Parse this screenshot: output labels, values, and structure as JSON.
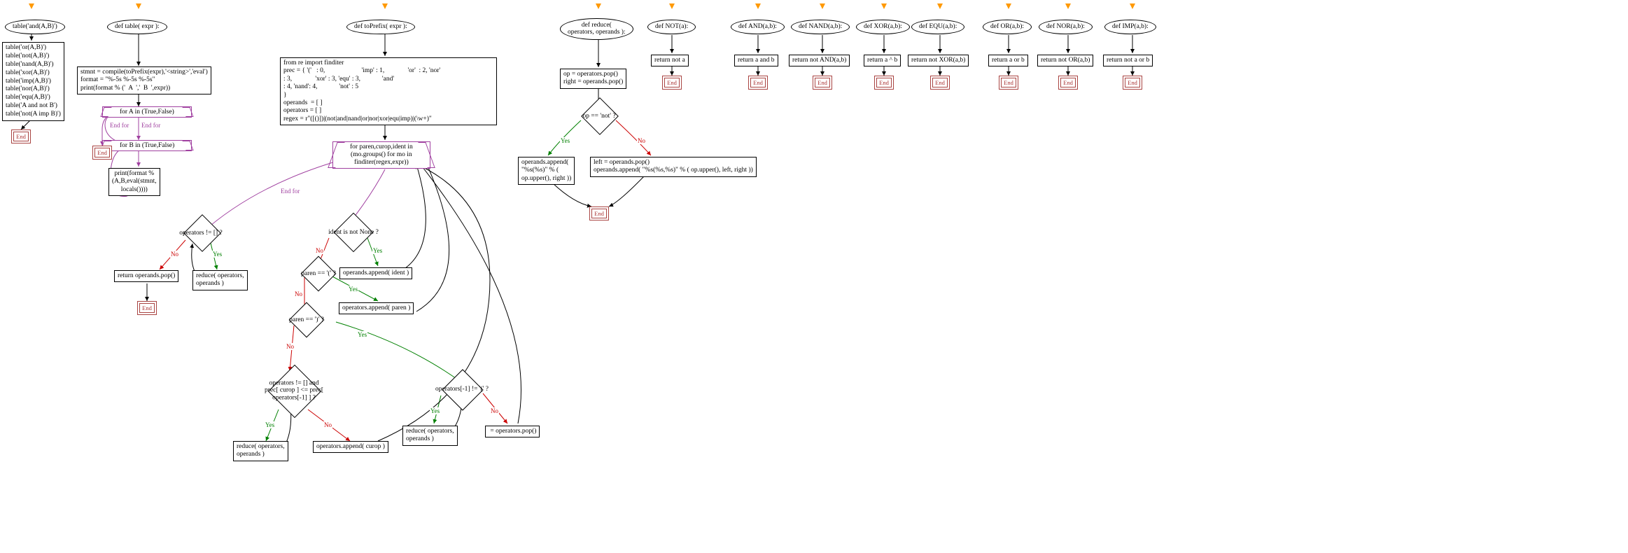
{
  "fc1": {
    "entry": "table('and(A,B)')",
    "calls": [
      "table('or(A,B)')",
      "table('not(A,B)')",
      "table('nand(A,B)')",
      "table('xor(A,B)')",
      "table('imp(A,B)')",
      "table('nor(A,B)')",
      "table('equ(A,B)')",
      "table('A and not B')",
      "table('not(A imp B)')"
    ],
    "end": "End"
  },
  "fc2": {
    "def": "def table( expr ):",
    "body1": "stmnt = compile(toPrefix(expr),'<string>','eval')\nformat = \"%-5s %-5s %-5s\"\nprint(format % ('  A  ','  B  ',expr))",
    "loopA": "for A in (True,False)",
    "loopB": "for B in (True,False)",
    "print": "print(format %\n(A,B,eval(stmnt,\nlocals())))",
    "endfor1": "End for",
    "endfor2": "End for",
    "end": "End"
  },
  "fc3": {
    "def": "def toPrefix( expr ):",
    "setup": "from re import finditer\nprec = { '('   : 0,                      'imp' : 1,              'or'  : 2, 'nor'\n: 3,              'xor' : 3, 'equ' : 3,             'and'\n: 4, 'nand': 4,             'not' : 5   \n}\noperands  = [ ]\noperators = [ ]\nregex = r\"([()])|(not|and|nand|or|nor|xor|equ|imp)|(\\w+)\"",
    "loop": "for paren,curop,ident in\n(mo.groups() for mo in\nfinditer(regex,expr))",
    "while1": "operators != [] ?",
    "reduce1": "reduce( operators,\noperands )",
    "ret": "return operands.pop()",
    "ident": "ident is not None ?",
    "app_ident": "operands.append( ident )",
    "paren_open": "paren == '(' ?",
    "app_paren": "operators.append( paren )",
    "paren_close": "paren == ')' ?",
    "while2": "operators[-1] != '(' ?",
    "reduce2": "reduce( operators,\noperands )",
    "popop": " = operators.pop()",
    "while3": "operators != [] and\nprec[ curop ] <= prec[\noperators[-1] ] ?",
    "reduce3": "reduce( operators,\noperands )",
    "app_curop": "operators.append( curop )",
    "endfor": "End for",
    "yes": "Yes",
    "no": "No",
    "end": "End"
  },
  "fc4": {
    "def": "def reduce(\noperators, operands ):",
    "pop": "op = operators.pop()\nright = operands.pop()",
    "cond": "op == 'not' ?",
    "then": "operands.append(\n\"%s(%s)\" % (\nop.upper(), right ))",
    "else": "left = operands.pop()\noperands.append( \"%s(%s,%s)\" % ( op.upper(), left, right ))",
    "yes": "Yes",
    "no": "No",
    "end": "End"
  },
  "fc5": {
    "def": "def NOT(a):",
    "ret": "return not a",
    "end": "End"
  },
  "fc6": {
    "def": "def AND(a,b):",
    "ret": "return a and b",
    "end": "End"
  },
  "fc7": {
    "def": "def NAND(a,b):",
    "ret": "return not AND(a,b)",
    "end": "End"
  },
  "fc8": {
    "def": "def XOR(a,b):",
    "ret": "return a ^ b",
    "end": "End"
  },
  "fc9": {
    "def": "def EQU(a,b):",
    "ret": "return not XOR(a,b)",
    "end": "End"
  },
  "fc10": {
    "def": "def OR(a,b):",
    "ret": "return a or b",
    "end": "End"
  },
  "fc11": {
    "def": "def NOR(a,b):",
    "ret": "return not OR(a,b)",
    "end": "End"
  },
  "fc12": {
    "def": "def IMP(a,b):",
    "ret": "return not a or b",
    "end": "End"
  },
  "chart_data": {
    "type": "flowchart",
    "graphs": [
      {
        "id": "main",
        "nodes": [
          {
            "id": "n1",
            "kind": "process",
            "label": "table('and(A,B)')"
          },
          {
            "id": "n2",
            "kind": "process",
            "label": "table('or(A,B)')\ntable('not(A,B)')\ntable('nand(A,B)')\ntable('xor(A,B)')\ntable('imp(A,B)')\ntable('nor(A,B)')\ntable('equ(A,B)')\ntable('A and not B')\ntable('not(A imp B)')"
          },
          {
            "id": "n3",
            "kind": "end",
            "label": "End"
          }
        ],
        "edges": [
          [
            "entry",
            "n1"
          ],
          [
            "n1",
            "n2"
          ],
          [
            "n2",
            "n3"
          ]
        ]
      },
      {
        "id": "table",
        "nodes": [
          {
            "id": "d",
            "kind": "oval",
            "label": "def table( expr ):"
          },
          {
            "id": "s1",
            "kind": "process",
            "label": "stmnt = compile(toPrefix(expr),'<string>','eval')\nformat = \"%-5s %-5s %-5s\"\nprint(format % ('  A  ','  B  ',expr))"
          },
          {
            "id": "fA",
            "kind": "for",
            "label": "for A in (True,False)"
          },
          {
            "id": "fB",
            "kind": "for",
            "label": "for B in (True,False)"
          },
          {
            "id": "pr",
            "kind": "process",
            "label": "print(format % (A,B,eval(stmnt,locals())))"
          },
          {
            "id": "eA",
            "kind": "end",
            "label": "End"
          }
        ],
        "edges": [
          [
            "entry",
            "d"
          ],
          [
            "d",
            "s1"
          ],
          [
            "s1",
            "fA"
          ],
          [
            "fA",
            "fB",
            "body"
          ],
          [
            "fB",
            "pr",
            "body"
          ],
          [
            "pr",
            "fB"
          ],
          [
            "fB",
            "fA",
            "End for"
          ],
          [
            "fA",
            "eA",
            "End for"
          ]
        ]
      },
      {
        "id": "toPrefix",
        "nodes": [
          {
            "id": "d",
            "kind": "oval",
            "label": "def toPrefix( expr ):"
          },
          {
            "id": "init",
            "kind": "process",
            "label": "from re import finditer; prec = {...}; operands=[]; operators=[]; regex=r\"([()])|(not|and|nand|or|nor|xor|equ|imp)|(\\w+)\""
          },
          {
            "id": "for",
            "kind": "for",
            "label": "for paren,curop,ident in (mo.groups() for mo in finditer(regex,expr))"
          },
          {
            "id": "w1",
            "kind": "decision",
            "label": "operators != [] ?"
          },
          {
            "id": "r1",
            "kind": "process",
            "label": "reduce(operators,operands)"
          },
          {
            "id": "ret",
            "kind": "process",
            "label": "return operands.pop()"
          },
          {
            "id": "id",
            "kind": "decision",
            "label": "ident is not None ?"
          },
          {
            "id": "ai",
            "kind": "process",
            "label": "operands.append(ident)"
          },
          {
            "id": "po",
            "kind": "decision",
            "label": "paren == '(' ?"
          },
          {
            "id": "ap",
            "kind": "process",
            "label": "operators.append(paren)"
          },
          {
            "id": "pc",
            "kind": "decision",
            "label": "paren == ')' ?"
          },
          {
            "id": "w2",
            "kind": "decision",
            "label": "operators[-1] != '(' ?"
          },
          {
            "id": "r2",
            "kind": "process",
            "label": "reduce(operators,operands)"
          },
          {
            "id": "pop",
            "kind": "process",
            "label": "= operators.pop()"
          },
          {
            "id": "w3",
            "kind": "decision",
            "label": "operators != [] and prec[curop] <= prec[operators[-1]] ?"
          },
          {
            "id": "r3",
            "kind": "process",
            "label": "reduce(operators,operands)"
          },
          {
            "id": "ac",
            "kind": "process",
            "label": "operators.append(curop)"
          },
          {
            "id": "end",
            "kind": "end",
            "label": "End"
          }
        ],
        "edges": [
          [
            "entry",
            "d"
          ],
          [
            "d",
            "init"
          ],
          [
            "init",
            "for"
          ],
          [
            "for",
            "id",
            "body"
          ],
          [
            "for",
            "w1",
            "End for"
          ],
          [
            "w1",
            "r1",
            "Yes"
          ],
          [
            "r1",
            "w1"
          ],
          [
            "w1",
            "ret",
            "No"
          ],
          [
            "ret",
            "end"
          ],
          [
            "id",
            "ai",
            "Yes"
          ],
          [
            "ai",
            "for"
          ],
          [
            "id",
            "po",
            "No"
          ],
          [
            "po",
            "ap",
            "Yes"
          ],
          [
            "ap",
            "for"
          ],
          [
            "po",
            "pc",
            "No"
          ],
          [
            "pc",
            "w2",
            "Yes"
          ],
          [
            "pc",
            "w3",
            "No"
          ],
          [
            "w2",
            "r2",
            "Yes"
          ],
          [
            "r2",
            "w2"
          ],
          [
            "w2",
            "pop",
            "No"
          ],
          [
            "pop",
            "for"
          ],
          [
            "w3",
            "r3",
            "Yes"
          ],
          [
            "r3",
            "w3"
          ],
          [
            "w3",
            "ac",
            "No"
          ],
          [
            "ac",
            "for"
          ]
        ]
      },
      {
        "id": "reduce",
        "nodes": [
          {
            "id": "d",
            "kind": "oval",
            "label": "def reduce(operators, operands):"
          },
          {
            "id": "p",
            "kind": "process",
            "label": "op = operators.pop()\nright = operands.pop()"
          },
          {
            "id": "c",
            "kind": "decision",
            "label": "op == 'not' ?"
          },
          {
            "id": "t",
            "kind": "process",
            "label": "operands.append(\"%s(%s)\" % (op.upper(), right))"
          },
          {
            "id": "e",
            "kind": "process",
            "label": "left = operands.pop()\noperands.append(\"%s(%s,%s)\" % (op.upper(), left, right))"
          },
          {
            "id": "end",
            "kind": "end",
            "label": "End"
          }
        ],
        "edges": [
          [
            "entry",
            "d"
          ],
          [
            "d",
            "p"
          ],
          [
            "p",
            "c"
          ],
          [
            "c",
            "t",
            "Yes"
          ],
          [
            "c",
            "e",
            "No"
          ],
          [
            "t",
            "end"
          ],
          [
            "e",
            "end"
          ]
        ]
      },
      {
        "id": "NOT",
        "nodes": [
          {
            "id": "d",
            "kind": "oval",
            "label": "def NOT(a):"
          },
          {
            "id": "r",
            "kind": "process",
            "label": "return not a"
          },
          {
            "id": "e",
            "kind": "end"
          }
        ],
        "edges": [
          [
            "entry",
            "d"
          ],
          [
            "d",
            "r"
          ],
          [
            "r",
            "e"
          ]
        ]
      },
      {
        "id": "AND",
        "nodes": [
          {
            "id": "d",
            "kind": "oval",
            "label": "def AND(a,b):"
          },
          {
            "id": "r",
            "kind": "process",
            "label": "return a and b"
          },
          {
            "id": "e",
            "kind": "end"
          }
        ],
        "edges": [
          [
            "entry",
            "d"
          ],
          [
            "d",
            "r"
          ],
          [
            "r",
            "e"
          ]
        ]
      },
      {
        "id": "NAND",
        "nodes": [
          {
            "id": "d",
            "kind": "oval",
            "label": "def NAND(a,b):"
          },
          {
            "id": "r",
            "kind": "process",
            "label": "return not AND(a,b)"
          },
          {
            "id": "e",
            "kind": "end"
          }
        ],
        "edges": [
          [
            "entry",
            "d"
          ],
          [
            "d",
            "r"
          ],
          [
            "r",
            "e"
          ]
        ]
      },
      {
        "id": "XOR",
        "nodes": [
          {
            "id": "d",
            "kind": "oval",
            "label": "def XOR(a,b):"
          },
          {
            "id": "r",
            "kind": "process",
            "label": "return a ^ b"
          },
          {
            "id": "e",
            "kind": "end"
          }
        ],
        "edges": [
          [
            "entry",
            "d"
          ],
          [
            "d",
            "r"
          ],
          [
            "r",
            "e"
          ]
        ]
      },
      {
        "id": "EQU",
        "nodes": [
          {
            "id": "d",
            "kind": "oval",
            "label": "def EQU(a,b):"
          },
          {
            "id": "r",
            "kind": "process",
            "label": "return not XOR(a,b)"
          },
          {
            "id": "e",
            "kind": "end"
          }
        ],
        "edges": [
          [
            "entry",
            "d"
          ],
          [
            "d",
            "r"
          ],
          [
            "r",
            "e"
          ]
        ]
      },
      {
        "id": "OR",
        "nodes": [
          {
            "id": "d",
            "kind": "oval",
            "label": "def OR(a,b):"
          },
          {
            "id": "r",
            "kind": "process",
            "label": "return a or b"
          },
          {
            "id": "e",
            "kind": "end"
          }
        ],
        "edges": [
          [
            "entry",
            "d"
          ],
          [
            "d",
            "r"
          ],
          [
            "r",
            "e"
          ]
        ]
      },
      {
        "id": "NOR",
        "nodes": [
          {
            "id": "d",
            "kind": "oval",
            "label": "def NOR(a,b):"
          },
          {
            "id": "r",
            "kind": "process",
            "label": "return not OR(a,b)"
          },
          {
            "id": "e",
            "kind": "end"
          }
        ],
        "edges": [
          [
            "entry",
            "d"
          ],
          [
            "d",
            "r"
          ],
          [
            "r",
            "e"
          ]
        ]
      },
      {
        "id": "IMP",
        "nodes": [
          {
            "id": "d",
            "kind": "oval",
            "label": "def IMP(a,b):"
          },
          {
            "id": "r",
            "kind": "process",
            "label": "return not a or b"
          },
          {
            "id": "e",
            "kind": "end"
          }
        ],
        "edges": [
          [
            "entry",
            "d"
          ],
          [
            "d",
            "r"
          ],
          [
            "r",
            "e"
          ]
        ]
      }
    ]
  }
}
